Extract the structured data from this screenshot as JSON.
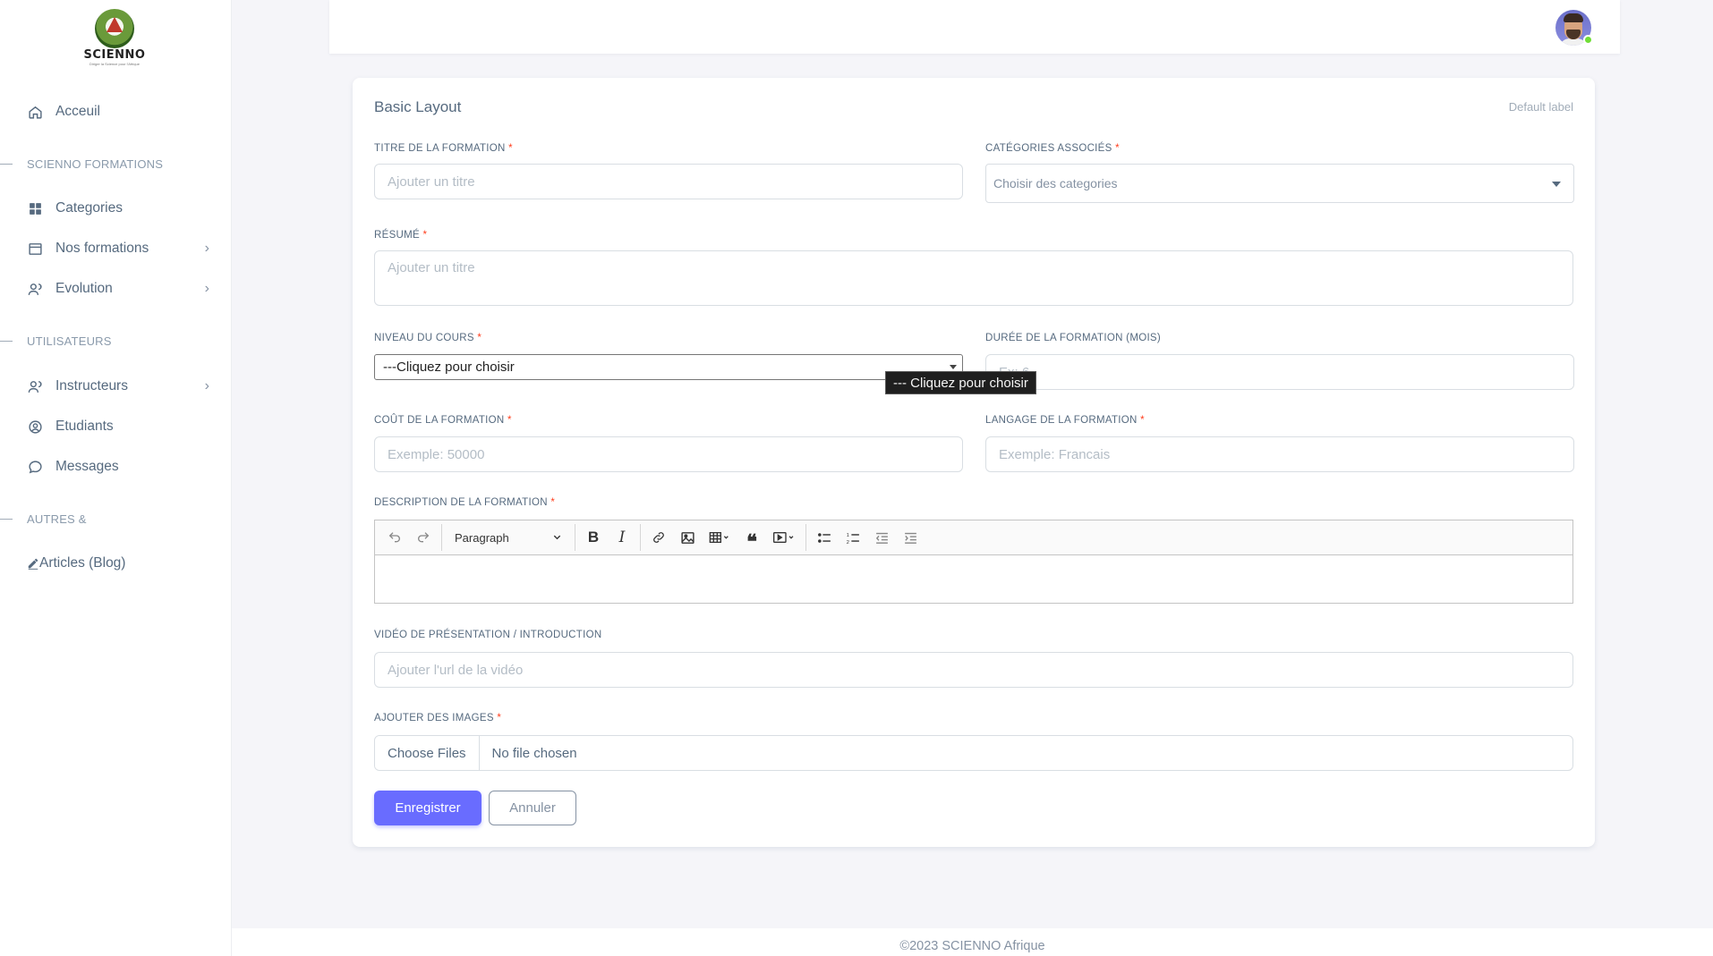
{
  "brand": {
    "name": "SCIENNO",
    "tagline": "Diriger la Science pour l'Afrique"
  },
  "sidebar": {
    "items_top": [
      {
        "label": "Acceuil",
        "icon": "home-icon"
      }
    ],
    "section1": {
      "label": "SCIENNO FORMATIONS"
    },
    "items_formations": [
      {
        "label": "Categories",
        "icon": "grid-icon"
      },
      {
        "label": "Nos formations",
        "icon": "window-icon"
      },
      {
        "label": "Evolution",
        "icon": "users-icon"
      }
    ],
    "section2": {
      "label": "UTILISATEURS"
    },
    "items_users": [
      {
        "label": "Instructeurs",
        "icon": "users-icon"
      },
      {
        "label": "Etudiants",
        "icon": "user-circle-icon"
      },
      {
        "label": "Messages",
        "icon": "chat-icon"
      }
    ],
    "section3": {
      "label": "AUTRES &"
    },
    "items_other": [
      {
        "label": "Articles (Blog)",
        "icon": "pencil-icon"
      }
    ]
  },
  "card": {
    "title": "Basic Layout",
    "badge": "Default label"
  },
  "form": {
    "titre": {
      "label": "TITRE DE LA FORMATION",
      "placeholder": "Ajouter un titre"
    },
    "categories": {
      "label": "CATÉGORIES ASSOCIÉS",
      "placeholder": "Choisir des categories"
    },
    "resume": {
      "label": "RÉSUMÉ",
      "placeholder": "Ajouter un titre"
    },
    "niveau": {
      "label": "NIVEAU DU COURS",
      "selected": "---Cliquez pour choisir",
      "tooltip": "--- Cliquez pour choisir"
    },
    "duree": {
      "label": "DURÉE DE LA FORMATION (MOIS)",
      "placeholder": "Ex: 6"
    },
    "cout": {
      "label": "COÛT DE LA FORMATION",
      "placeholder": "Exemple: 50000"
    },
    "langage": {
      "label": "LANGAGE DE LA FORMATION",
      "placeholder": "Exemple: Francais"
    },
    "description": {
      "label": "DESCRIPTION DE LA FORMATION",
      "paragraph": "Paragraph"
    },
    "video": {
      "label": "VIDÉO DE PRÉSENTATION / INTRODUCTION",
      "placeholder": "Ajouter l'url de la vidéo"
    },
    "images": {
      "label": "AJOUTER DES IMAGES",
      "button": "Choose Files",
      "status": "No file chosen"
    },
    "required_mark": "*",
    "submit": "Enregistrer",
    "cancel": "Annuler"
  },
  "footer": {
    "text": "©2023 SCIENNO Afrique"
  },
  "colors": {
    "primary": "#696cff",
    "required": "#ff3e1d",
    "online": "#71dd37"
  }
}
